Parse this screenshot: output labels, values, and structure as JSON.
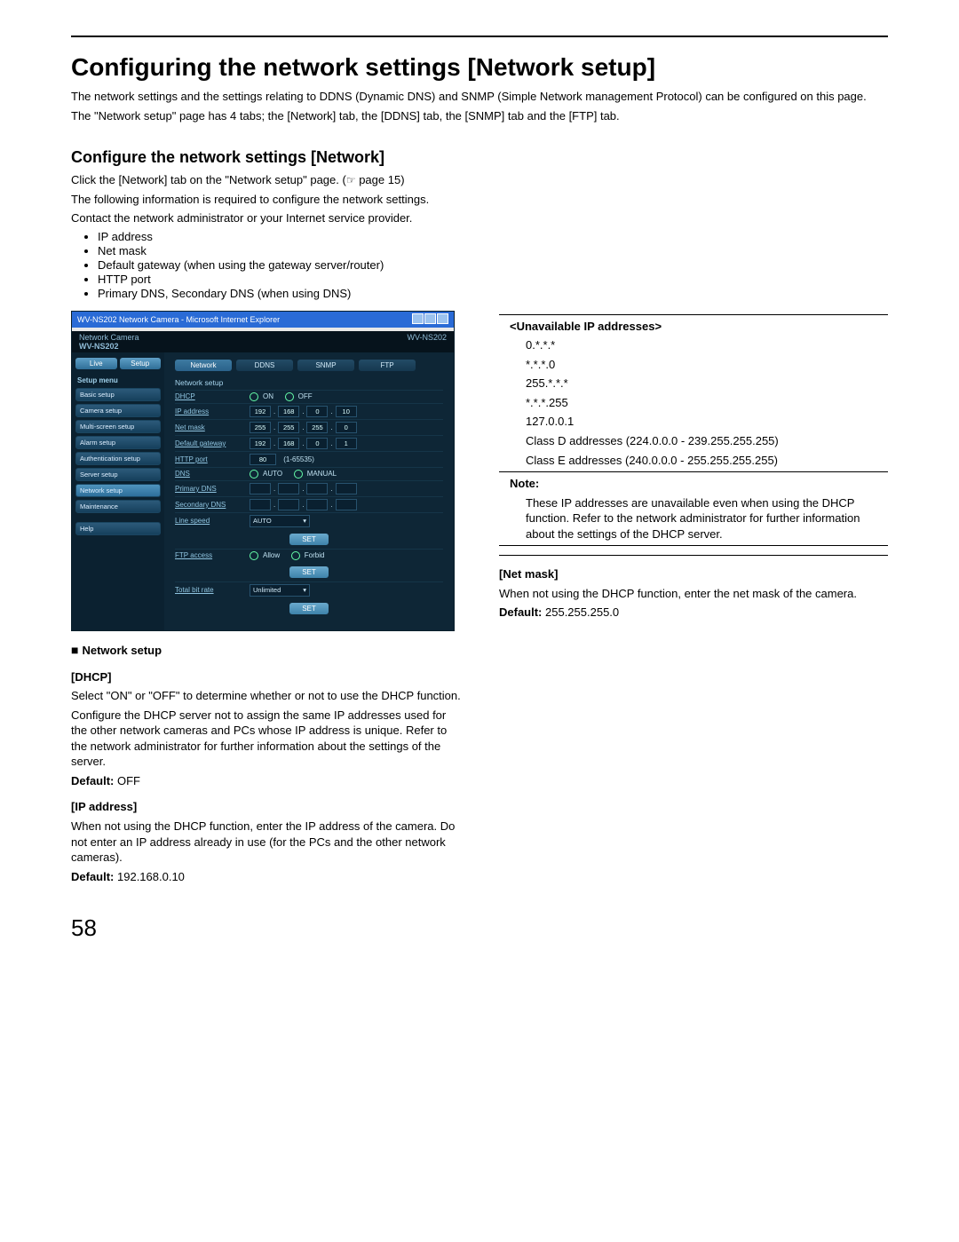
{
  "page_number": "58",
  "h1": "Configuring the network settings [Network setup]",
  "intro1": "The network settings and the settings relating to DDNS (Dynamic DNS) and SNMP (Simple Network management Protocol) can be configured on this page.",
  "intro2": "The \"Network setup\" page has 4 tabs; the [Network] tab, the [DDNS] tab, the [SNMP] tab and the [FTP] tab.",
  "h2": "Configure the network settings [Network]",
  "click_line_a": "Click the [Network] tab on the \"Network setup\" page. (",
  "click_line_b": " page 15)",
  "req_line": "The following information is required to configure the network settings.",
  "contact_line": "Contact the network administrator or your Internet service provider.",
  "bullets": {
    "b1": "IP address",
    "b2": "Net mask",
    "b3": "Default gateway (when using the gateway server/router)",
    "b4": "HTTP port",
    "b5": "Primary DNS, Secondary DNS (when using DNS)"
  },
  "app": {
    "titlebar": "WV-NS202 Network Camera - Microsoft Internet Explorer",
    "brand_left": "Network Camera",
    "brand_model": "WV-NS202",
    "brand_right": "WV-NS202",
    "sb_live": "Live",
    "sb_setup": "Setup",
    "sb_menu": "Setup menu",
    "sb_items": {
      "i1": "Basic setup",
      "i2": "Camera setup",
      "i3": "Multi-screen setup",
      "i4": "Alarm setup",
      "i5": "Authentication setup",
      "i6": "Server setup",
      "i7": "Network setup",
      "i8": "Maintenance",
      "i9": "Help"
    },
    "tabs": {
      "t1": "Network",
      "t2": "DDNS",
      "t3": "SNMP",
      "t4": "FTP"
    },
    "sec1": "Network setup",
    "fields": {
      "dhcp": "DHCP",
      "dhcp_on": "ON",
      "dhcp_off": "OFF",
      "ip": "IP address",
      "ip1": "192",
      "ip2": "168",
      "ip3": "0",
      "ip4": "10",
      "mask": "Net mask",
      "m1": "255",
      "m2": "255",
      "m3": "255",
      "m4": "0",
      "gw": "Default gateway",
      "g1": "192",
      "g2": "168",
      "g3": "0",
      "g4": "1",
      "http": "HTTP port",
      "httpv": "80",
      "httprange": "(1-65535)",
      "dns": "DNS",
      "dns_auto": "AUTO",
      "dns_manual": "MANUAL",
      "pdns": "Primary DNS",
      "sdns": "Secondary DNS",
      "speed": "Line speed",
      "speedv": "AUTO",
      "set": "SET",
      "ftp": "FTP access",
      "ftp_allow": "Allow",
      "ftp_forbid": "Forbid",
      "bitrate": "Total bit rate",
      "bitratev": "Unlimited"
    }
  },
  "left_text": {
    "section": "Network setup",
    "dhcp_h": "[DHCP]",
    "dhcp_p1": "Select \"ON\" or \"OFF\" to determine whether or not to use the DHCP function.",
    "dhcp_p2": "Configure the DHCP server not to assign the same IP addresses used for the other network cameras and PCs whose IP address is unique. Refer to the network administrator for further information about the settings of the server.",
    "dhcp_def_l": "Default:",
    "dhcp_def_v": " OFF",
    "ip_h": "[IP address]",
    "ip_p": "When not using the DHCP function, enter the IP address of the camera. Do not enter an IP address already in use (for the PCs and the other network cameras).",
    "ip_def_l": "Default:",
    "ip_def_v": " 192.168.0.10"
  },
  "right_text": {
    "unavail_h": "<Unavailable IP addresses>",
    "l1": "0.*.*.*",
    "l2": "*.*.*.0",
    "l3": "255.*.*.*",
    "l4": "*.*.*.255",
    "l5": "127.0.0.1",
    "l6": "Class D addresses (224.0.0.0 - 239.255.255.255)",
    "l7": "Class E addresses (240.0.0.0 - 255.255.255.255)",
    "note_h": "Note:",
    "note_p": "These IP addresses are unavailable even when using the DHCP function. Refer to the network administrator for further information about the settings of the DHCP server.",
    "netmask_h": "[Net mask]",
    "netmask_p": "When not using the DHCP function, enter the net mask of the camera.",
    "nm_def_l": "Default:",
    "nm_def_v": " 255.255.255.0"
  }
}
